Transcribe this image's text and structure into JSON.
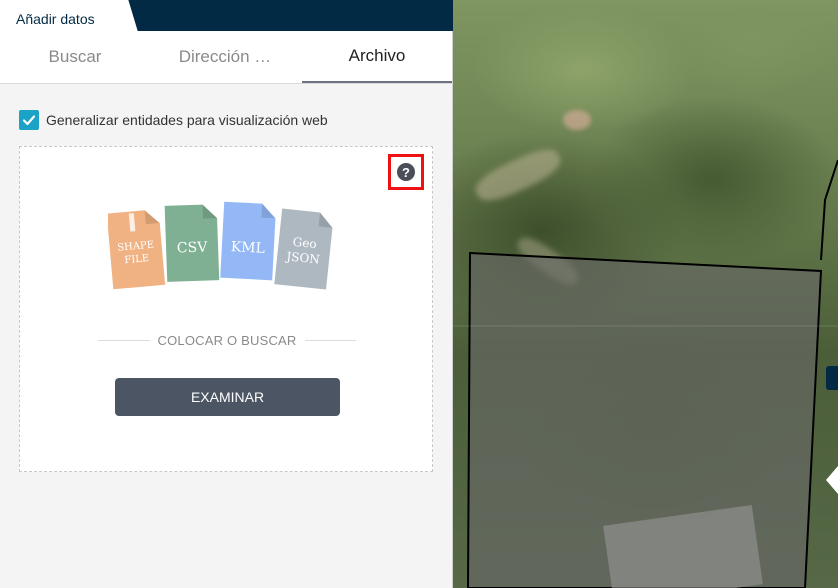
{
  "panel": {
    "title": "Añadir datos",
    "tabs": [
      {
        "label": "Buscar",
        "active": false
      },
      {
        "label": "Dirección …",
        "active": false
      },
      {
        "label": "Archivo",
        "active": true
      }
    ]
  },
  "options": {
    "generalize_label": "Generalizar entidades para visualización web",
    "generalize_checked": true
  },
  "dropzone": {
    "help_icon": "question-circle-icon",
    "file_types": [
      {
        "line1": "SHAPE",
        "line2": "FILE",
        "color": "#f0b283"
      },
      {
        "line1": "CSV",
        "line2": "",
        "color": "#7fb093"
      },
      {
        "line1": "KML",
        "line2": "",
        "color": "#93b8f5"
      },
      {
        "line1": "Geo",
        "line2": "JSON",
        "color": "#aeb8c1"
      }
    ],
    "drop_text": "COLOCAR O BUSCAR",
    "browse_label": "EXAMINAR"
  },
  "colors": {
    "header_bg": "#032a45",
    "checkbox": "#1aa3c6",
    "button_bg": "#4b5563",
    "help_highlight": "#ee1111"
  }
}
